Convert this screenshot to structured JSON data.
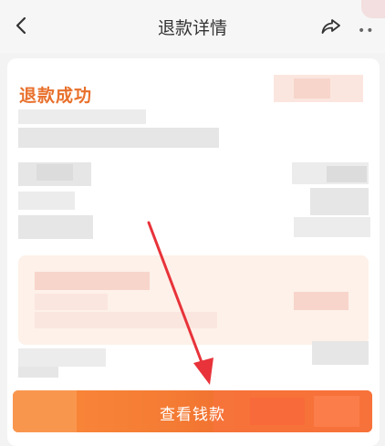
{
  "header": {
    "title": "退款详情",
    "back_icon": "chevron-left-icon",
    "share_icon": "share-icon"
  },
  "refund": {
    "status": "退款成功"
  },
  "action": {
    "view_money_label": "查看钱款"
  },
  "colors": {
    "accent": "#e8702c",
    "button": "#f47b33",
    "arrow": "#e8333a"
  }
}
